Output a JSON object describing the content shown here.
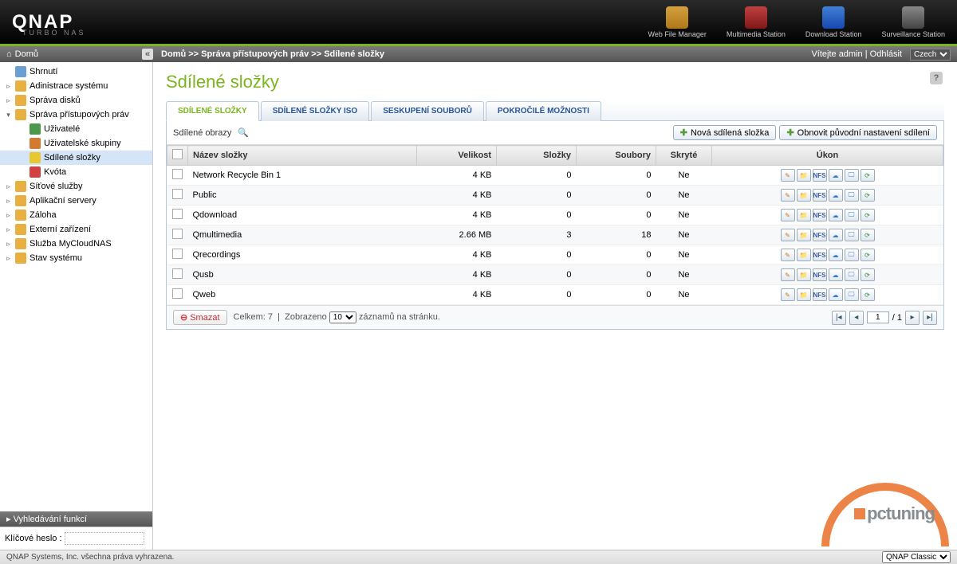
{
  "brand": {
    "logo": "QNAP",
    "sublogo": "TURBO NAS"
  },
  "header_apps": [
    {
      "label": "Web File Manager",
      "cls": "hi-folder"
    },
    {
      "label": "Multimedia Station",
      "cls": "hi-media"
    },
    {
      "label": "Download Station",
      "cls": "hi-download"
    },
    {
      "label": "Surveillance Station",
      "cls": "hi-surveillance"
    }
  ],
  "topbar": {
    "home": "Domů",
    "breadcrumb": "Domů >> Správa přístupových práv >> Sdílené složky",
    "welcome": "Vítejte admin",
    "logout": "Odhlásit",
    "language": "Czech"
  },
  "sidebar": {
    "items": [
      {
        "label": "Shrnutí",
        "icon": "ic-sum",
        "level": 1,
        "toggle": ""
      },
      {
        "label": "Adinistrace systému",
        "icon": "ic-folder",
        "level": 1,
        "toggle": "▹"
      },
      {
        "label": "Správa disků",
        "icon": "ic-folder",
        "level": 1,
        "toggle": "▹"
      },
      {
        "label": "Správa přístupových práv",
        "icon": "ic-folder",
        "level": 1,
        "toggle": "▾",
        "expanded": true
      },
      {
        "label": "Uživatelé",
        "icon": "ic-user",
        "level": 2,
        "toggle": ""
      },
      {
        "label": "Uživatelské skupiny",
        "icon": "ic-users",
        "level": 2,
        "toggle": ""
      },
      {
        "label": "Sdílené složky",
        "icon": "ic-share",
        "level": 2,
        "toggle": "",
        "selected": true
      },
      {
        "label": "Kvóta",
        "icon": "ic-quota",
        "level": 2,
        "toggle": ""
      },
      {
        "label": "Síťové služby",
        "icon": "ic-folder",
        "level": 1,
        "toggle": "▹"
      },
      {
        "label": "Aplikační servery",
        "icon": "ic-folder",
        "level": 1,
        "toggle": "▹"
      },
      {
        "label": "Záloha",
        "icon": "ic-folder",
        "level": 1,
        "toggle": "▹"
      },
      {
        "label": "Externí zařízení",
        "icon": "ic-folder",
        "level": 1,
        "toggle": "▹"
      },
      {
        "label": "Služba MyCloudNAS",
        "icon": "ic-folder",
        "level": 1,
        "toggle": "▹"
      },
      {
        "label": "Stav systému",
        "icon": "ic-folder",
        "level": 1,
        "toggle": "▹"
      }
    ],
    "search_header": "Vyhledávání funkcí",
    "search_label": "Klíčové heslo :"
  },
  "content": {
    "title": "Sdílené složky",
    "tabs": [
      {
        "label": "SDÍLENÉ SLOŽKY",
        "active": true
      },
      {
        "label": "SDÍLENÉ SLOŽKY ISO",
        "active": false
      },
      {
        "label": "SESKUPENÍ SOUBORŮ",
        "active": false
      },
      {
        "label": "POKROČILÉ MOŽNOSTI",
        "active": false
      }
    ],
    "toolbar": {
      "label": "Sdílené obrazy",
      "new_folder": "Nová sdílená složka",
      "restore": "Obnovit původní nastavení sdílení"
    },
    "columns": {
      "name": "Název složky",
      "size": "Velikost",
      "folders": "Složky",
      "files": "Soubory",
      "hidden": "Skryté",
      "action": "Úkon"
    },
    "rows": [
      {
        "name": "Network Recycle Bin 1",
        "size": "4 KB",
        "folders": 0,
        "files": 0,
        "hidden": "Ne"
      },
      {
        "name": "Public",
        "size": "4 KB",
        "folders": 0,
        "files": 0,
        "hidden": "Ne"
      },
      {
        "name": "Qdownload",
        "size": "4 KB",
        "folders": 0,
        "files": 0,
        "hidden": "Ne"
      },
      {
        "name": "Qmultimedia",
        "size": "2.66 MB",
        "folders": 3,
        "files": 18,
        "hidden": "Ne"
      },
      {
        "name": "Qrecordings",
        "size": "4 KB",
        "folders": 0,
        "files": 0,
        "hidden": "Ne"
      },
      {
        "name": "Qusb",
        "size": "4 KB",
        "folders": 0,
        "files": 0,
        "hidden": "Ne"
      },
      {
        "name": "Qweb",
        "size": "4 KB",
        "folders": 0,
        "files": 0,
        "hidden": "Ne"
      }
    ],
    "footer": {
      "delete": "Smazat",
      "total_label": "Celkem:",
      "total": 7,
      "shown_label": "Zobrazeno",
      "per_page": 10,
      "per_page_suffix": "záznamů na stránku.",
      "page": 1,
      "pages": 1
    }
  },
  "page_footer": {
    "copyright": "QNAP Systems, Inc. všechna práva vyhrazena.",
    "theme": "QNAP Classic"
  },
  "watermark": "pctuning"
}
